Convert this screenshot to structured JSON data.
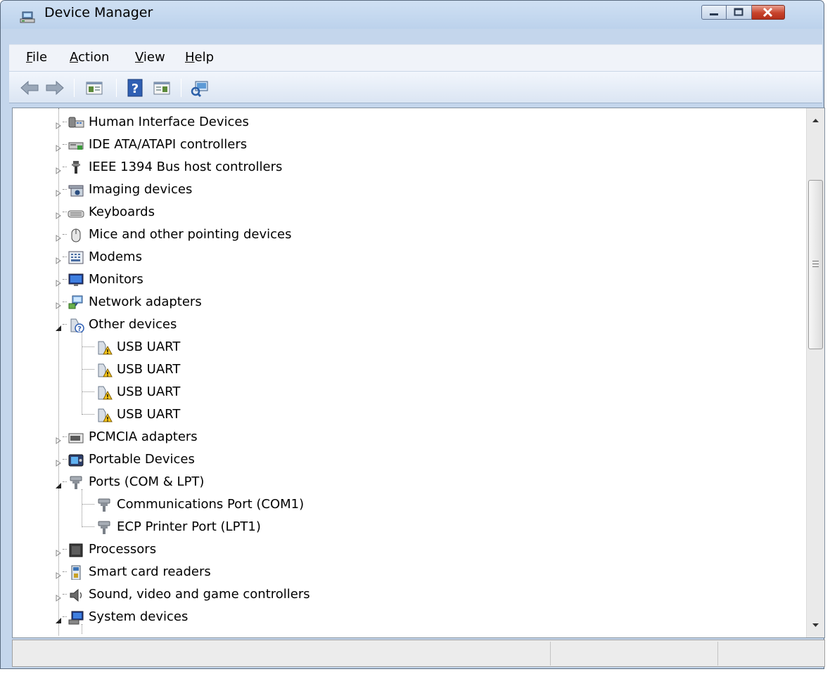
{
  "window": {
    "title": "Device Manager"
  },
  "menu": [
    {
      "label": "File",
      "mnemonic": "F",
      "rest": "ile"
    },
    {
      "label": "Action",
      "mnemonic": "A",
      "rest": "ction"
    },
    {
      "label": "View",
      "mnemonic": "V",
      "rest": "iew"
    },
    {
      "label": "Help",
      "mnemonic": "H",
      "rest": "elp"
    }
  ],
  "toolbar": {
    "back_icon": "back-arrow-icon",
    "forward_icon": "forward-arrow-icon",
    "console_tree_icon": "show-hide-console-tree-icon",
    "help_icon": "help-icon",
    "action_pane_icon": "show-hide-action-pane-icon",
    "scan_icon": "scan-hardware-icon"
  },
  "tree": {
    "rows": [
      {
        "label": "Human Interface Devices",
        "level": 1,
        "expander": "collapsed",
        "icon": "human-interface-devices-icon"
      },
      {
        "label": "IDE ATA/ATAPI controllers",
        "level": 1,
        "expander": "collapsed",
        "icon": "ide-controller-icon"
      },
      {
        "label": "IEEE 1394 Bus host controllers",
        "level": 1,
        "expander": "collapsed",
        "icon": "ieee1394-icon"
      },
      {
        "label": "Imaging devices",
        "level": 1,
        "expander": "collapsed",
        "icon": "imaging-device-icon"
      },
      {
        "label": "Keyboards",
        "level": 1,
        "expander": "collapsed",
        "icon": "keyboard-icon"
      },
      {
        "label": "Mice and other pointing devices",
        "level": 1,
        "expander": "collapsed",
        "icon": "mouse-icon"
      },
      {
        "label": "Modems",
        "level": 1,
        "expander": "collapsed",
        "icon": "modem-icon"
      },
      {
        "label": "Monitors",
        "level": 1,
        "expander": "collapsed",
        "icon": "monitor-icon"
      },
      {
        "label": "Network adapters",
        "level": 1,
        "expander": "collapsed",
        "icon": "network-adapter-icon"
      },
      {
        "label": "Other devices",
        "level": 1,
        "expander": "expanded",
        "icon": "unknown-device-icon"
      },
      {
        "label": "USB UART",
        "level": 2,
        "expander": "none",
        "icon": "warning-device-icon"
      },
      {
        "label": "USB UART",
        "level": 2,
        "expander": "none",
        "icon": "warning-device-icon"
      },
      {
        "label": "USB UART",
        "level": 2,
        "expander": "none",
        "icon": "warning-device-icon"
      },
      {
        "label": "USB UART",
        "level": 2,
        "expander": "none",
        "icon": "warning-device-icon"
      },
      {
        "label": "PCMCIA adapters",
        "level": 1,
        "expander": "collapsed",
        "icon": "pcmcia-icon"
      },
      {
        "label": "Portable Devices",
        "level": 1,
        "expander": "collapsed",
        "icon": "portable-device-icon"
      },
      {
        "label": "Ports (COM & LPT)",
        "level": 1,
        "expander": "expanded",
        "icon": "port-icon"
      },
      {
        "label": "Communications Port (COM1)",
        "level": 2,
        "expander": "none",
        "icon": "port-icon"
      },
      {
        "label": "ECP Printer Port (LPT1)",
        "level": 2,
        "expander": "none",
        "icon": "port-icon"
      },
      {
        "label": "Processors",
        "level": 1,
        "expander": "collapsed",
        "icon": "processor-icon"
      },
      {
        "label": "Smart card readers",
        "level": 1,
        "expander": "collapsed",
        "icon": "smart-card-reader-icon"
      },
      {
        "label": "Sound, video and game controllers",
        "level": 1,
        "expander": "collapsed",
        "icon": "speaker-icon"
      },
      {
        "label": "System devices",
        "level": 1,
        "expander": "expanded",
        "icon": "system-device-icon"
      }
    ]
  },
  "scrollbar": {
    "up_icon": "scroll-up-arrow-icon",
    "down_icon": "scroll-down-arrow-icon",
    "grip_icon": "scroll-grip-icon"
  },
  "statusbar": {
    "text": ""
  }
}
